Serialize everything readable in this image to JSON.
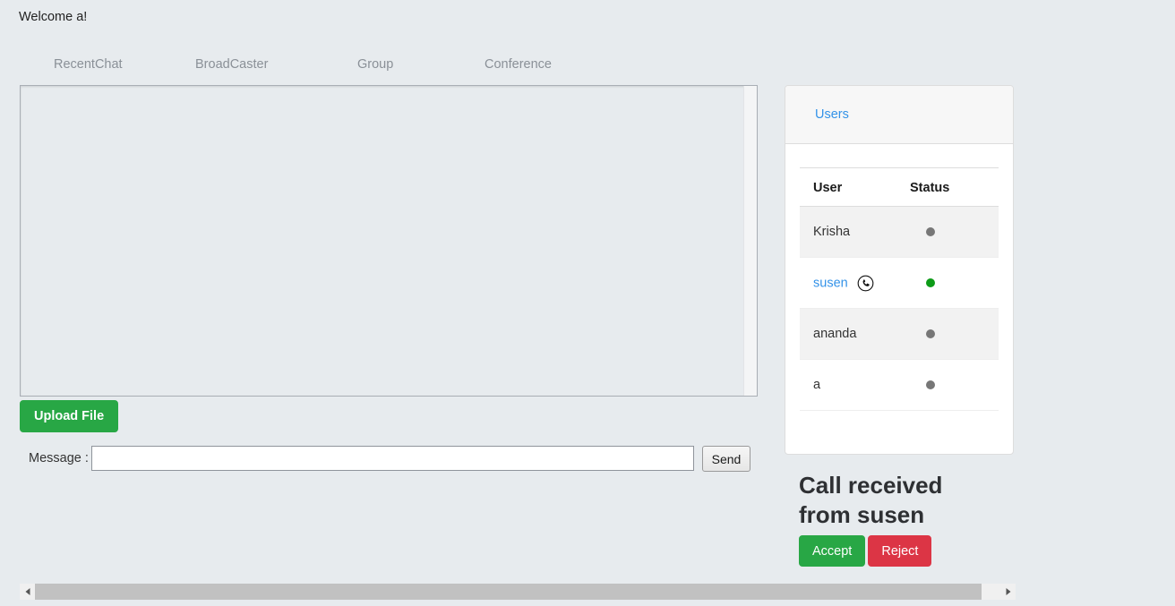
{
  "welcome": {
    "text": "Welcome a!"
  },
  "tabs": [
    {
      "label": "RecentChat"
    },
    {
      "label": "BroadCaster"
    },
    {
      "label": "Group"
    },
    {
      "label": "Conference"
    }
  ],
  "chat": {
    "content": ""
  },
  "toolbar": {
    "upload_label": "Upload File"
  },
  "message": {
    "label": "Message :",
    "value": "",
    "placeholder": "",
    "send_label": "Send"
  },
  "users_panel": {
    "title": "Users",
    "columns": {
      "user": "User",
      "status": "Status"
    },
    "rows": [
      {
        "name": "Krisha",
        "status": "offline",
        "is_link": false,
        "has_call_icon": false
      },
      {
        "name": "susen",
        "status": "online",
        "is_link": true,
        "has_call_icon": true
      },
      {
        "name": "ananda",
        "status": "offline",
        "is_link": false,
        "has_call_icon": false
      },
      {
        "name": "a",
        "status": "offline",
        "is_link": false,
        "has_call_icon": false
      }
    ]
  },
  "call_notification": {
    "text": "Call received from susen",
    "accept_label": "Accept",
    "reject_label": "Reject"
  },
  "colors": {
    "page_background": "#e7ebee",
    "accent_link": "#3392e8",
    "success": "#28a745",
    "danger": "#dc3545",
    "online_dot": "#0d9b18",
    "offline_dot": "#777777"
  },
  "icons": {
    "call": "phone-circle-icon",
    "scroll_left": "arrow-left-icon",
    "scroll_right": "arrow-right-icon"
  }
}
